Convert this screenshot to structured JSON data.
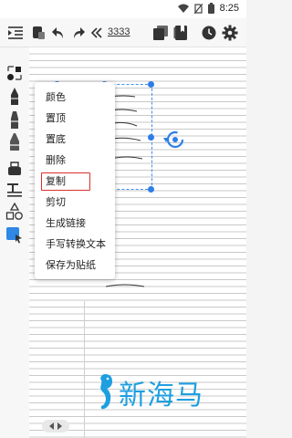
{
  "status_bar": {
    "time": "8:25",
    "icons": [
      "wifi-icon",
      "no-sim-icon",
      "battery-icon"
    ]
  },
  "toolbar": {
    "page_number": "3333",
    "icons": [
      "list-collapse-icon",
      "eraser-icon",
      "undo-icon",
      "redo-icon",
      "double-chevron-left-icon",
      "layers-icon",
      "bookmark-book-icon",
      "clock-icon",
      "gear-icon"
    ]
  },
  "left_tools": [
    "lasso-select-icon",
    "pen-icon",
    "marker-icon",
    "highlighter-icon",
    "eraser-tool-icon",
    "text-tool-icon",
    "shapes-icon",
    "selection-tool-icon"
  ],
  "scroll_indicator": {
    "top": "1",
    "bottom": "3"
  },
  "context_menu": {
    "items": [
      "颜色",
      "置顶",
      "置底",
      "删除",
      "复制",
      "剪切",
      "生成链接",
      "手写转换文本",
      "保存为贴纸"
    ],
    "highlighted_item": "复制"
  },
  "watermark": {
    "text": "新海马"
  },
  "colors": {
    "selection": "#2e7de9",
    "highlight_border": "#d9302e",
    "watermark": "#1d9fe0"
  }
}
